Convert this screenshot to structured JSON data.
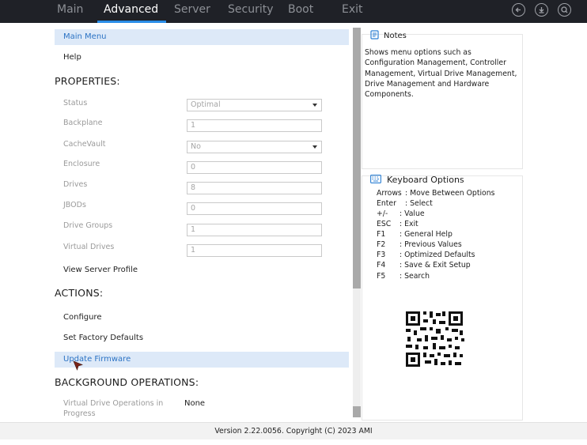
{
  "tabs": [
    {
      "label": "Main",
      "active": false
    },
    {
      "label": "Advanced",
      "active": true
    },
    {
      "label": "Server",
      "active": false
    },
    {
      "label": "Security",
      "active": false
    },
    {
      "label": "Boot",
      "active": false
    },
    {
      "label": "Exit",
      "active": false
    }
  ],
  "top_icons": [
    "back-icon",
    "download-icon",
    "search-icon"
  ],
  "menu": {
    "main_menu": "Main Menu",
    "help": "Help"
  },
  "properties": {
    "heading": "PROPERTIES:",
    "status": {
      "label": "Status",
      "value": "Optimal"
    },
    "backplane": {
      "label": "Backplane",
      "value": "1"
    },
    "cachevault": {
      "label": "CacheVault",
      "value": "No"
    },
    "enclosure": {
      "label": "Enclosure",
      "value": "0"
    },
    "drives": {
      "label": "Drives",
      "value": "8"
    },
    "jbods": {
      "label": "JBODs",
      "value": "0"
    },
    "drive_groups": {
      "label": "Drive Groups",
      "value": "1"
    },
    "virtual_drives": {
      "label": "Virtual Drives",
      "value": "1"
    },
    "view_server_profile": "View Server Profile"
  },
  "actions": {
    "heading": "ACTIONS:",
    "configure": "Configure",
    "set_factory_defaults": "Set Factory Defaults",
    "update_firmware": "Update Firmware"
  },
  "background": {
    "heading": "BACKGROUND OPERATIONS:",
    "vd_ops_label_1": "Virtual Drive Operations in",
    "vd_ops_label_2": "Progress",
    "vd_ops_value": "None"
  },
  "notes": {
    "title": "Notes",
    "body": "Shows menu options such as Configuration Management, Controller Management, Virtual Drive Management, Drive Management and Hardware Components."
  },
  "keyboard": {
    "title": "Keyboard Options",
    "options": [
      {
        "key": "Arrows",
        "desc": ": Move Between Options"
      },
      {
        "key": "Enter",
        "desc": ": Select"
      },
      {
        "key": "+/-",
        "desc": ": Value"
      },
      {
        "key": "ESC",
        "desc": ": Exit"
      },
      {
        "key": "F1",
        "desc": ": General Help"
      },
      {
        "key": "F2",
        "desc": ": Previous Values"
      },
      {
        "key": "F3",
        "desc": ": Optimized Defaults"
      },
      {
        "key": "F4",
        "desc": ": Save & Exit Setup"
      },
      {
        "key": "F5",
        "desc": ": Search"
      }
    ]
  },
  "footer": {
    "version": "Version 2.22.0056. Copyright (C) 2023 AMI"
  },
  "colors": {
    "accent": "#2b8ee8",
    "topbar": "#1f2127",
    "highlight": "#dde9f8",
    "link": "#2c73c4"
  }
}
